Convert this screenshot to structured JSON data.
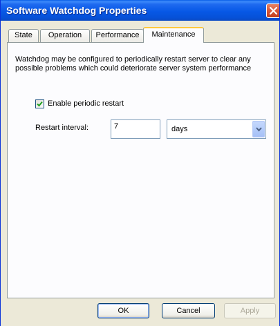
{
  "window": {
    "title": "Software Watchdog Properties"
  },
  "tabs": [
    "State",
    "Operation",
    "Performance",
    "Maintenance"
  ],
  "maintenance": {
    "description": "Watchdog may be configured to periodically restart server to clear any possible problems which could deteriorate server system performance",
    "enable_label": "Enable periodic restart",
    "enable_checked": true,
    "interval_label": "Restart interval:",
    "interval_value": "7",
    "interval_unit": "days"
  },
  "buttons": {
    "ok": "OK",
    "cancel": "Cancel",
    "apply": "Apply"
  },
  "colors": {
    "titlebar": "#0758E6",
    "accent_tab": "#FFC83C",
    "dialog_bg": "#ECE9D8"
  }
}
